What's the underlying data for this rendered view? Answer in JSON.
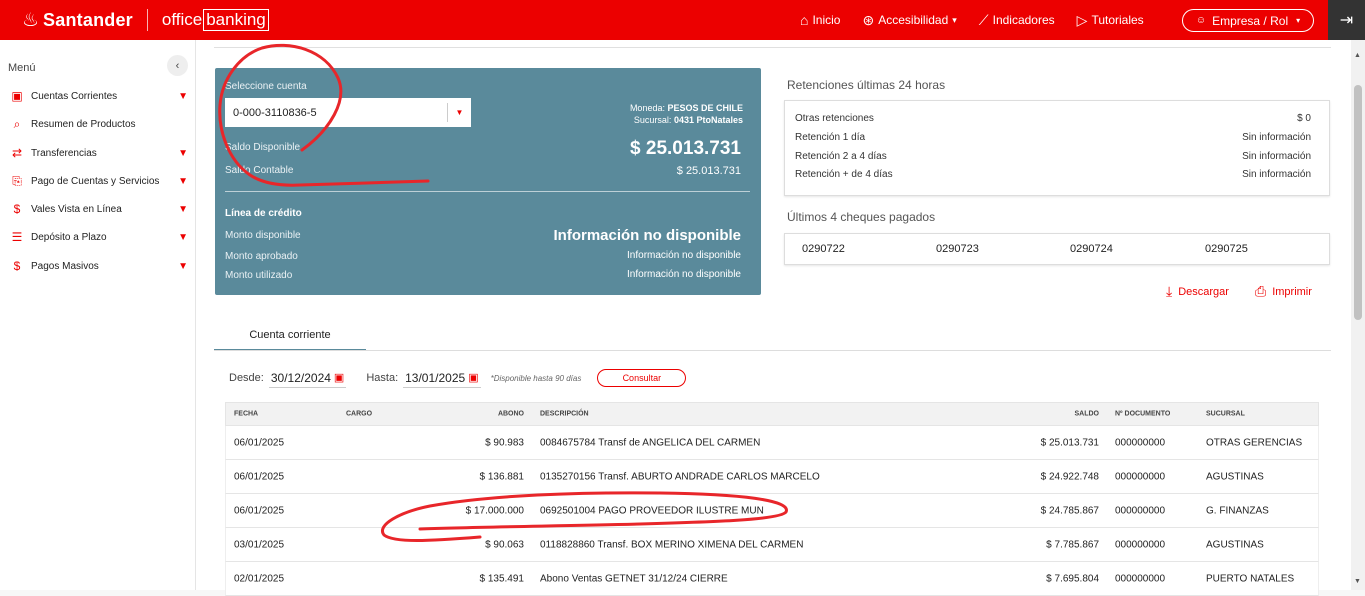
{
  "header": {
    "brand": "Santander",
    "product_office": "office",
    "product_banking": "banking",
    "nav": [
      {
        "label": "Inicio",
        "icon": "home-icon"
      },
      {
        "label": "Accesibilidad",
        "icon": "accessibility-icon"
      },
      {
        "label": "Indicadores",
        "icon": "chart-icon"
      },
      {
        "label": "Tutoriales",
        "icon": "play-icon"
      }
    ],
    "role_button": "Empresa / Rol"
  },
  "sidebar": {
    "title": "Menú",
    "items": [
      {
        "label": "Cuentas Corrientes",
        "has_submenu": true
      },
      {
        "label": "Resumen de Productos",
        "has_submenu": false
      },
      {
        "label": "Transferencias",
        "has_submenu": true
      },
      {
        "label": "Pago de Cuentas y Servicios",
        "has_submenu": true
      },
      {
        "label": "Vales Vista en Línea",
        "has_submenu": true
      },
      {
        "label": "Depósito a Plazo",
        "has_submenu": true
      },
      {
        "label": "Pagos Masivos",
        "has_submenu": true
      }
    ]
  },
  "account_card": {
    "select_label": "Seleccione cuenta",
    "account": "0-000-3110836-5",
    "currency_label": "Moneda:",
    "currency": "PESOS DE CHILE",
    "branch_label": "Sucursal:",
    "branch": "0431 PtoNatales",
    "available_label": "Saldo Disponible",
    "available": "$ 25.013.731",
    "accounting_label": "Saldo Contable",
    "accounting": "$ 25.013.731",
    "credit_title": "Línea de crédito",
    "credit_available_label": "Monto disponible",
    "credit_available": "Información no disponible",
    "credit_approved_label": "Monto aprobado",
    "credit_approved": "Información no disponible",
    "credit_used_label": "Monto utilizado",
    "credit_used": "Información no disponible"
  },
  "retentions": {
    "title": "Retenciones últimas 24 horas",
    "rows": [
      {
        "label": "Otras retenciones",
        "value": "$ 0"
      },
      {
        "label": "Retención 1 día",
        "value": "Sin información"
      },
      {
        "label": "Retención 2 a 4 días",
        "value": "Sin información"
      },
      {
        "label": "Retención + de 4 días",
        "value": "Sin información"
      }
    ]
  },
  "cheques": {
    "title": "Últimos 4 cheques pagados",
    "numbers": [
      "0290722",
      "0290723",
      "0290724",
      "0290725"
    ]
  },
  "actions": {
    "download": "Descargar",
    "print": "Imprimir"
  },
  "tab": {
    "label": "Cuenta corriente"
  },
  "filters": {
    "from_label": "Desde:",
    "from_value": "30/12/2024",
    "to_label": "Hasta:",
    "to_value": "13/01/2025",
    "note": "*Disponible hasta 90 días",
    "submit": "Consultar"
  },
  "table": {
    "headers": {
      "fecha": "FECHA",
      "cargo": "CARGO",
      "abono": "ABONO",
      "descripcion": "DESCRIPCIÓN",
      "saldo": "SALDO",
      "documento": "Nº DOCUMENTO",
      "sucursal": "SUCURSAL"
    },
    "rows": [
      {
        "fecha": "06/01/2025",
        "cargo": "",
        "abono": "$ 90.983",
        "descripcion": "0084675784 Transf de ANGELICA DEL CARMEN",
        "saldo": "$ 25.013.731",
        "documento": "000000000",
        "sucursal": "OTRAS GERENCIAS"
      },
      {
        "fecha": "06/01/2025",
        "cargo": "",
        "abono": "$ 136.881",
        "descripcion": "0135270156 Transf. ABURTO ANDRADE CARLOS MARCELO",
        "saldo": "$ 24.922.748",
        "documento": "000000000",
        "sucursal": "AGUSTINAS"
      },
      {
        "fecha": "06/01/2025",
        "cargo": "",
        "abono": "$ 17.000.000",
        "descripcion": "0692501004 PAGO PROVEEDOR ILUSTRE MUN",
        "saldo": "$ 24.785.867",
        "documento": "000000000",
        "sucursal": "G. FINANZAS"
      },
      {
        "fecha": "03/01/2025",
        "cargo": "",
        "abono": "$ 90.063",
        "descripcion": "0118828860 Transf. BOX MERINO XIMENA DEL CARMEN",
        "saldo": "$ 7.785.867",
        "documento": "000000000",
        "sucursal": "AGUSTINAS"
      },
      {
        "fecha": "02/01/2025",
        "cargo": "",
        "abono": "$ 135.491",
        "descripcion": "Abono Ventas GETNET 31/12/24 CIERRE",
        "saldo": "$ 7.695.804",
        "documento": "000000000",
        "sucursal": "PUERTO NATALES"
      }
    ]
  },
  "colors": {
    "brand_red": "#ec0000",
    "card_teal": "#5a8a9b",
    "annotation_red": "#e8262a"
  }
}
